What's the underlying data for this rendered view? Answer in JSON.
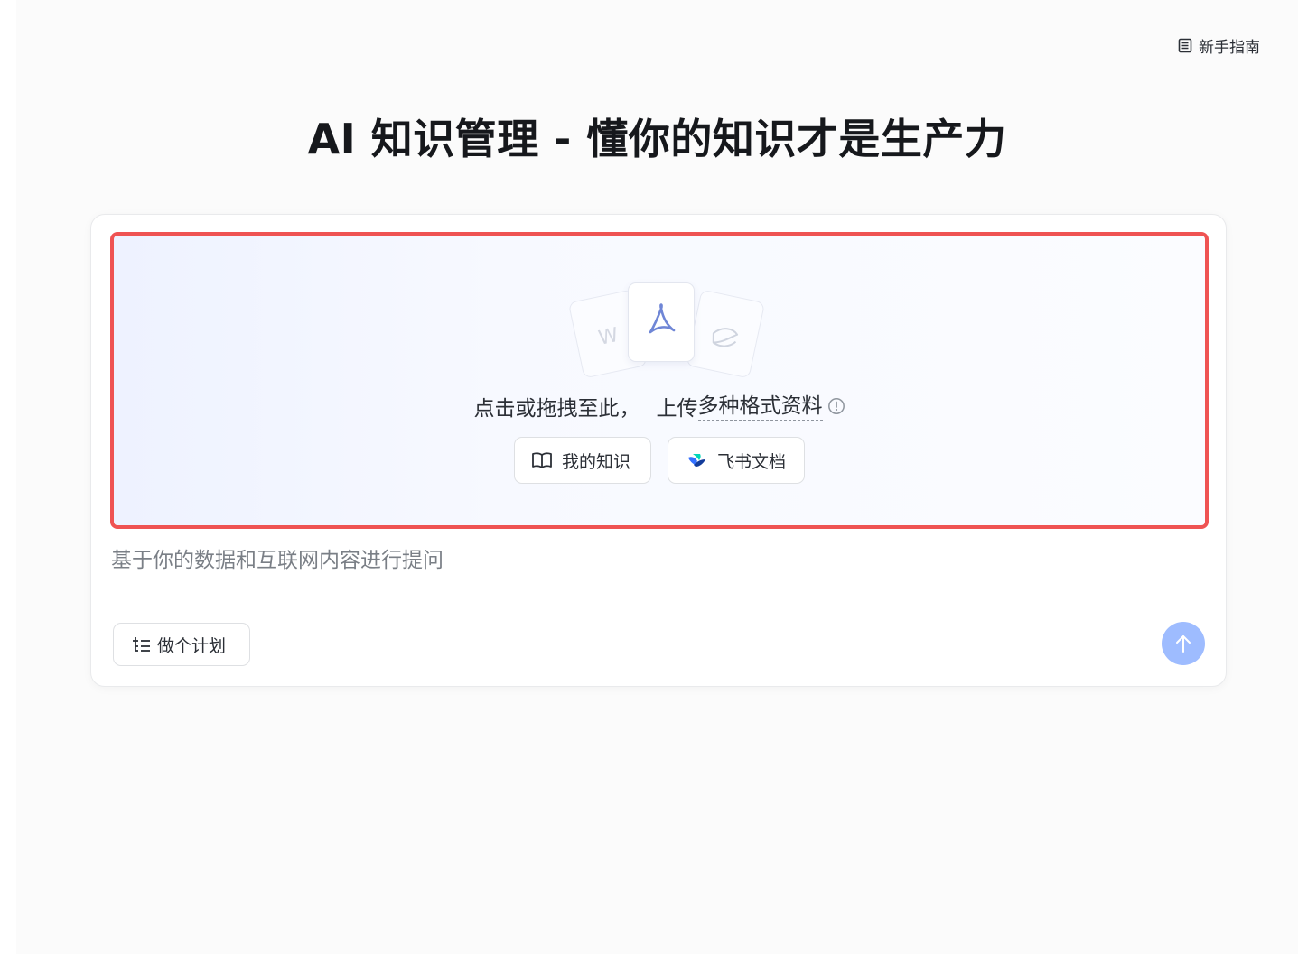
{
  "header": {
    "guide_link_label": "新手指南",
    "guide_icon": "document-icon"
  },
  "page_title": "AI 知识管理 - 懂你的知识才是生产力",
  "upload": {
    "file_icons": [
      "word-file-icon",
      "pdf-file-icon",
      "lark-file-icon"
    ],
    "word_letter": "W",
    "hint_prefix": "点击或拖拽至此，",
    "hint_action": "上传",
    "hint_formats": "多种格式资料",
    "info_icon": "info-icon",
    "highlight_color": "#ef5353"
  },
  "sources": {
    "my_knowledge_label": "我的知识",
    "my_knowledge_icon": "book-icon",
    "feishu_label": "飞书文档",
    "feishu_icon": "feishu-logo-icon"
  },
  "query": {
    "placeholder": "基于你的数据和互联网内容进行提问",
    "value": ""
  },
  "actions": {
    "plan_label": "做个计划",
    "plan_icon": "list-icon",
    "send_icon": "arrow-up-icon",
    "send_color": "#9ebcff"
  }
}
